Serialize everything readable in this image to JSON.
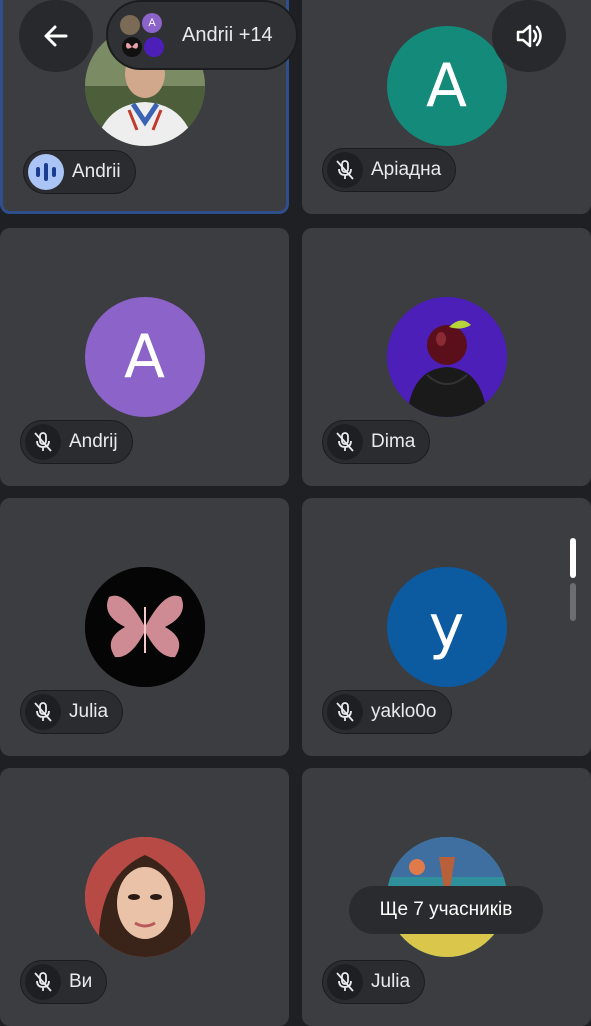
{
  "header": {
    "back_icon": "arrow-left-icon",
    "participants_summary": "Andrii +14",
    "mini_avatar_letter": "A",
    "speaker_icon": "speaker-icon"
  },
  "tiles": [
    {
      "name": "Andrii",
      "avatar": "photo-man",
      "mic": "speaking",
      "active": true
    },
    {
      "name": "Аріадна",
      "avatar_letter": "A",
      "avatar_color": "#138a7a",
      "mic": "muted"
    },
    {
      "name": "Andrij",
      "avatar_letter": "A",
      "avatar_color": "#8b63c9",
      "mic": "muted"
    },
    {
      "name": "Dima",
      "avatar": "photo-apple-hoodie",
      "mic": "muted"
    },
    {
      "name": "Julia",
      "avatar": "photo-butterfly",
      "mic": "muted"
    },
    {
      "name": "yaklo0o",
      "avatar_letter": "у",
      "avatar_color": "#0c5aa0",
      "mic": "muted"
    },
    {
      "name": "Ви",
      "avatar": "photo-woman",
      "mic": "muted"
    },
    {
      "name": "Julia",
      "avatar": "photo-painting",
      "mic": "muted"
    }
  ],
  "overflow_toast": "Ще 7 учасників",
  "colors": {
    "background": "#1f2023",
    "tile": "#3c3d40",
    "active_border": "#2f4f8c",
    "speaking_chip": "#aac4f5"
  }
}
